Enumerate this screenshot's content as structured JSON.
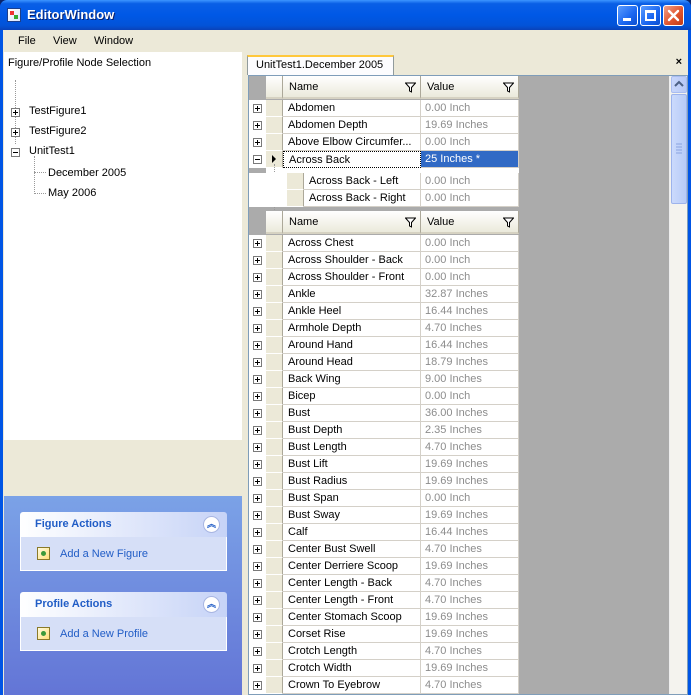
{
  "window": {
    "title": "EditorWindow"
  },
  "menu": [
    "File",
    "View",
    "Window"
  ],
  "left": {
    "title": "Figure/Profile Node Selection",
    "tree": [
      {
        "label": "TestFigure1",
        "expander": "plus"
      },
      {
        "label": "TestFigure2",
        "expander": "plus"
      },
      {
        "label": "UnitTest1",
        "expander": "minus"
      },
      {
        "label": "December 2005",
        "expander": "none"
      },
      {
        "label": "May 2006",
        "expander": "none"
      }
    ]
  },
  "taskpane": {
    "figure": {
      "title": "Figure Actions",
      "link": "Add a New Figure"
    },
    "profile": {
      "title": "Profile Actions",
      "link": "Add a New Profile"
    }
  },
  "tab": {
    "label": "UnitTest1.December 2005",
    "close": "×"
  },
  "grid": {
    "col_name": "Name",
    "col_value": "Value",
    "top_rows": [
      {
        "name": "Abdomen",
        "value": "0.00 Inch"
      },
      {
        "name": "Abdomen Depth",
        "value": "19.69 Inches"
      },
      {
        "name": "Above Elbow Circumfer...",
        "value": "0.00 Inch"
      },
      {
        "name": "Across Back",
        "value": "25 Inches *"
      }
    ],
    "child_rows": [
      {
        "name": "Across Back - Left",
        "value": "0.00 Inch"
      },
      {
        "name": "Across Back - Right",
        "value": "0.00 Inch"
      }
    ],
    "rows": [
      {
        "name": "Across Chest",
        "value": "0.00 Inch"
      },
      {
        "name": "Across Shoulder - Back",
        "value": "0.00 Inch"
      },
      {
        "name": "Across Shoulder - Front",
        "value": "0.00 Inch"
      },
      {
        "name": "Ankle",
        "value": "32.87 Inches"
      },
      {
        "name": "Ankle Heel",
        "value": "16.44 Inches"
      },
      {
        "name": "Armhole Depth",
        "value": "4.70 Inches"
      },
      {
        "name": "Around Hand",
        "value": "16.44 Inches"
      },
      {
        "name": "Around Head",
        "value": "18.79 Inches"
      },
      {
        "name": "Back Wing",
        "value": "9.00 Inches"
      },
      {
        "name": "Bicep",
        "value": "0.00 Inch"
      },
      {
        "name": "Bust",
        "value": "36.00 Inches"
      },
      {
        "name": "Bust Depth",
        "value": "2.35 Inches"
      },
      {
        "name": "Bust Length",
        "value": "4.70 Inches"
      },
      {
        "name": "Bust Lift",
        "value": "19.69 Inches"
      },
      {
        "name": "Bust Radius",
        "value": "19.69 Inches"
      },
      {
        "name": "Bust Span",
        "value": "0.00 Inch"
      },
      {
        "name": "Bust Sway",
        "value": "19.69 Inches"
      },
      {
        "name": "Calf",
        "value": "16.44 Inches"
      },
      {
        "name": "Center Bust Swell",
        "value": "4.70 Inches"
      },
      {
        "name": "Center Derriere Scoop",
        "value": "19.69 Inches"
      },
      {
        "name": "Center Length - Back",
        "value": "4.70 Inches"
      },
      {
        "name": "Center Length - Front",
        "value": "4.70 Inches"
      },
      {
        "name": "Center Stomach Scoop",
        "value": "19.69 Inches"
      },
      {
        "name": "Corset Rise",
        "value": "19.69 Inches"
      },
      {
        "name": "Crotch Length",
        "value": "4.70 Inches"
      },
      {
        "name": "Crotch Width",
        "value": "19.69 Inches"
      },
      {
        "name": "Crown To Eyebrow",
        "value": "4.70 Inches"
      }
    ]
  }
}
